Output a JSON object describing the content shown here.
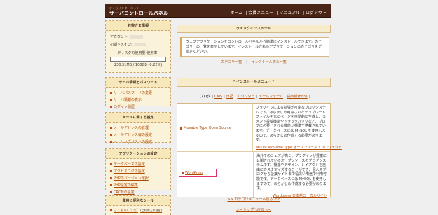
{
  "header": {
    "logo_small": "さくらインターネット",
    "logo_main": "サーバコントロールパネル",
    "nav": [
      "| ホーム",
      "| 会員メニュー",
      "| マニュアル",
      "| ログアウト"
    ]
  },
  "customer": {
    "title": "お客さま情報",
    "account_label": "アカウント:",
    "domain_label": "初期ドメイン:",
    "disk_title": "ディスクの使用量(使用率)",
    "disk_text": "230.31MB / 100GB (0.22%)",
    "disk_fraction": 0.0022
  },
  "server_info": {
    "title": "サーバ情報とパスワード",
    "items": [
      "サーバパスワードの変更",
      "サーバ情報の表示",
      "ログイン履歴"
    ]
  },
  "mail": {
    "title": "メールに関する設定",
    "items": [
      "メールアドレスの管理",
      "メールアドレス毎の設定",
      "メーリングリストの設定"
    ]
  },
  "app": {
    "title": "アプリケーションの設定",
    "items": [
      "データベースの設定",
      "アクセスログの設定",
      "PHPのバージョン選択",
      "PHP設定の編集",
      "CRONの設定"
    ]
  },
  "tools": {
    "title": "運用に便利なツール",
    "items": [
      {
        "label": "さくらのブログ",
        "note": "(ご利用上の注意)"
      }
    ]
  },
  "quick": {
    "title": "クイックインストール",
    "desc": "ウェブアプリケーションをコントロールパネルから簡単にインストールできます。カテゴリーの一覧を表示しています。インストールされるアプリケーションのカテゴリをご指定ください。",
    "link1": "カテゴリ一覧",
    "link2": "インストール済み一覧",
    "sep": "|"
  },
  "install_menu": {
    "title": "* インストールメニュー *",
    "tabs": [
      "ブログ",
      "CMS",
      "日記",
      "カウンター",
      "メールフォーム",
      "掲示板(BBS)"
    ],
    "active_tab": "ブログ"
  },
  "apps": [
    {
      "name": "Movable Type Open Source",
      "desc": "プラグインによる拡張が可能なブログシステムです。あらかじめ用意されたテンプレートファイルを元にページを自動的に生成し、コメント投稿機能やトラックバックなど、ブログに必要とされる機能が標準で搭載されています。データベースには MySQL を使用しますので、あらかじめ作成する必要があります。",
      "source": "MTOS: Movable Type オープンソース・プロジェクト"
    },
    {
      "name": "WordPress",
      "desc": "海外でのシェアが高く、プラグインが豊富に公開されているオープンソースのブログシステムです。機能やデザイン、レイアウトを自由にカスタマイズすることができ、個人用ブログから企業サイトまで幅広い用途で利用可能です。データベースには MySQL を使用しますので、あらかじめ作成する必要があります。",
      "source": "Wordpress 日本語ローカルサイト"
    }
  ],
  "footer": {
    "back_category": ">> カテゴリメニューへ戻る <<",
    "back_top": ">> トップへ戻る <<"
  },
  "colors": {
    "header_bg": "#4a2516",
    "link": "#b04b00",
    "highlight": "#e0306a",
    "box_bg": "#fbf3d9"
  }
}
